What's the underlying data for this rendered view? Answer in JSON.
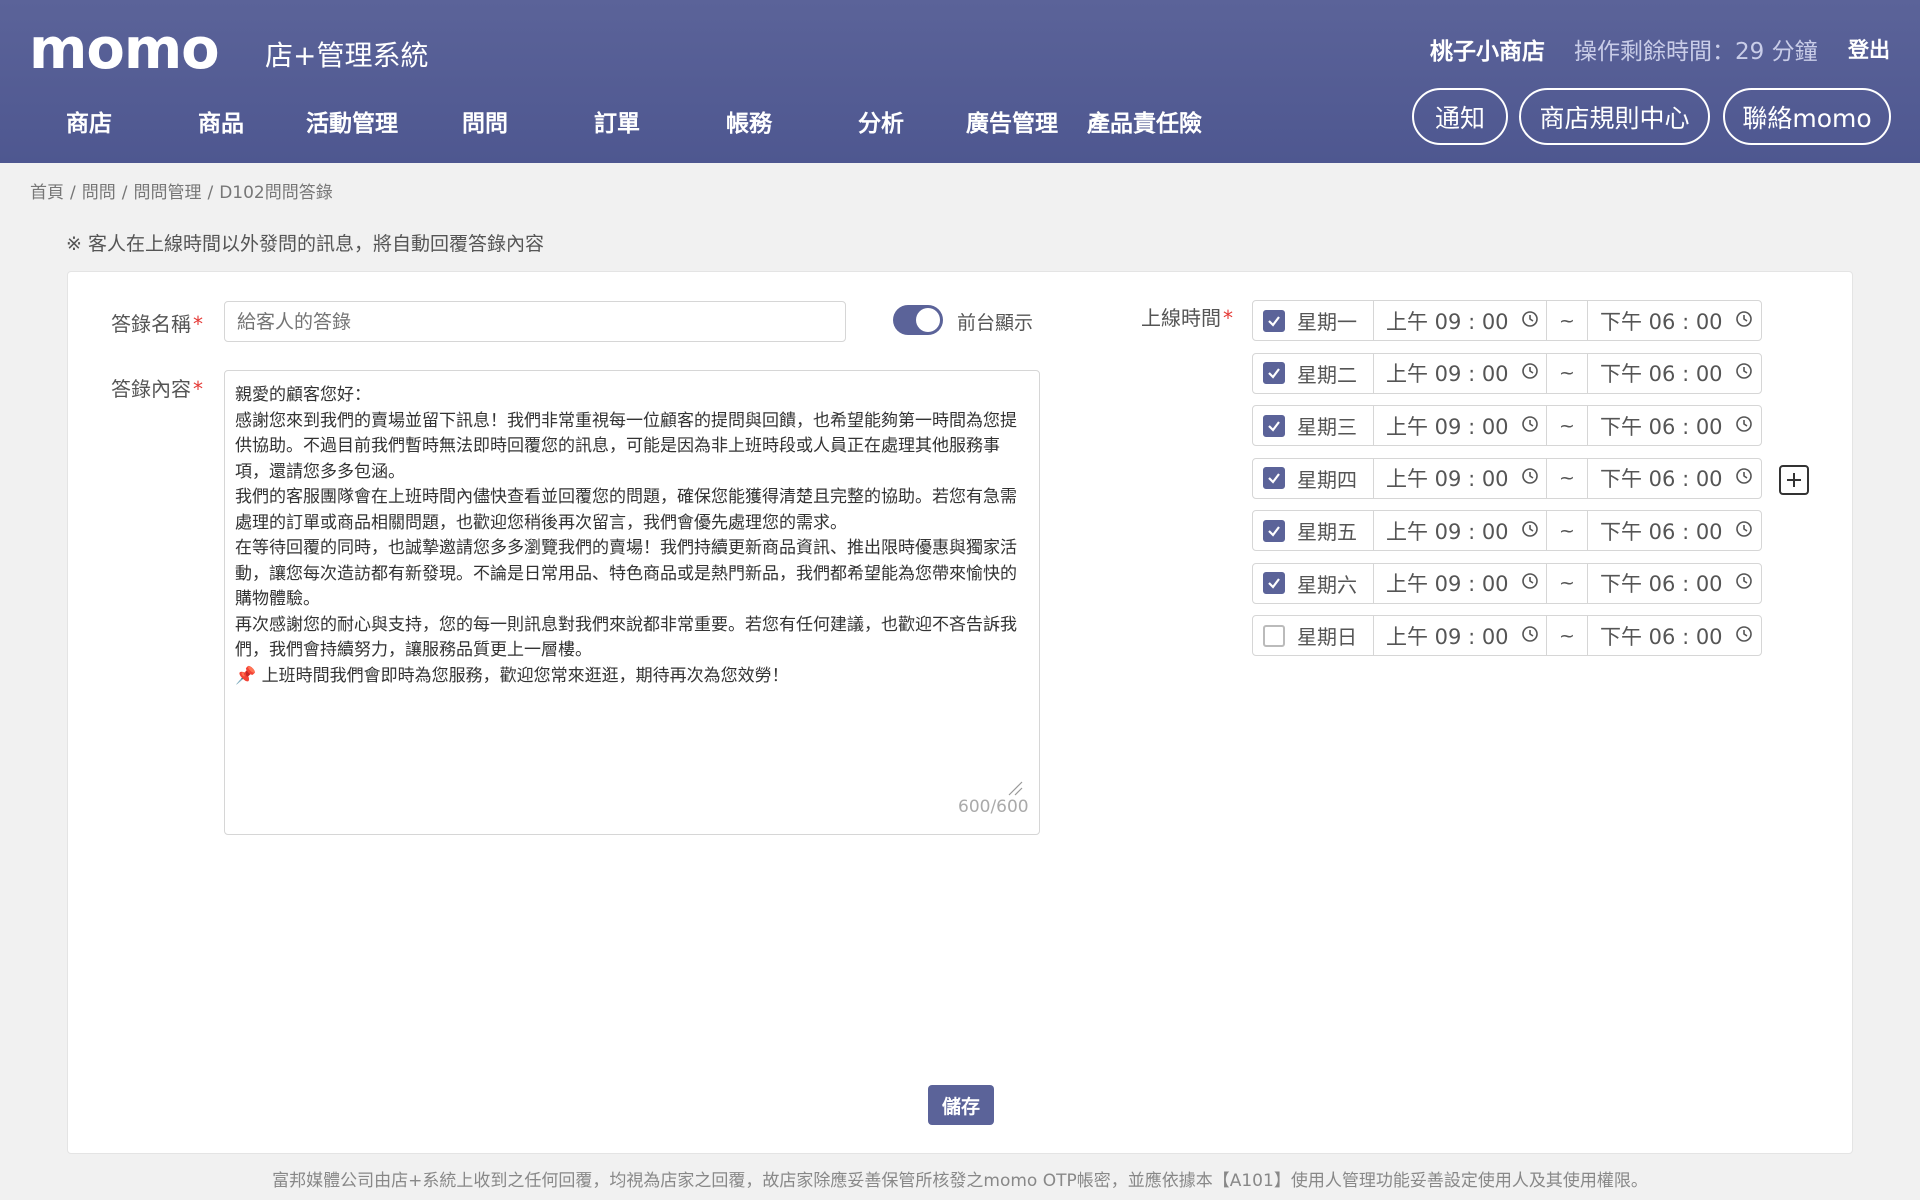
{
  "header": {
    "logo": "momo",
    "system_title": "店+管理系統",
    "shop_name": "桃子小商店",
    "remaining_time": "操作剩餘時間：29 分鐘",
    "logout": "登出",
    "nav": [
      "商店",
      "商品",
      "活動管理",
      "問問",
      "訂單",
      "帳務",
      "分析",
      "廣告管理",
      "產品責任險"
    ],
    "buttons": [
      "通知",
      "商店規則中心",
      "聯絡momo"
    ]
  },
  "breadcrumb": [
    "首頁",
    "問問",
    "問問管理",
    "D102問問答錄"
  ],
  "notice": "※ 客人在上線時間以外發問的訊息，將自動回覆答錄內容",
  "form": {
    "name_label": "答錄名稱",
    "name_placeholder": "給客人的答錄",
    "toggle_label": "前台顯示",
    "toggle_on": true,
    "content_label": "答錄內容",
    "content": "親愛的顧客您好：\n感謝您來到我們的賣場並留下訊息！我們非常重視每一位顧客的提問與回饋，也希望能夠第一時間為您提供協助。不過目前我們暫時無法即時回覆您的訊息，可能是因為非上班時段或人員正在處理其他服務事項，還請您多多包涵。\n我們的客服團隊會在上班時間內儘快查看並回覆您的問題，確保您能獲得清楚且完整的協助。若您有急需處理的訂單或商品相關問題，也歡迎您稍後再次留言，我們會優先處理您的需求。\n在等待回覆的同時，也誠摯邀請您多多瀏覽我們的賣場！我們持續更新商品資訊、推出限時優惠與獨家活動，讓您每次造訪都有新發現。不論是日常用品、特色商品或是熱門新品，我們都希望能為您帶來愉快的購物體驗。\n再次感謝您的耐心與支持，您的每一則訊息對我們來說都非常重要。若您有任何建議，也歡迎不吝告訴我們，我們會持續努力，讓服務品質更上一層樓。\n📌 上班時間我們會即時為您服務，歡迎您常來逛逛，期待再次為您效勞！",
    "counter": "600/600",
    "schedule_label": "上線時間",
    "schedule": [
      {
        "day": "星期一",
        "checked": true,
        "start": "上午 09 : 00",
        "end": "下午 06 : 00"
      },
      {
        "day": "星期二",
        "checked": true,
        "start": "上午 09 : 00",
        "end": "下午 06 : 00"
      },
      {
        "day": "星期三",
        "checked": true,
        "start": "上午 09 : 00",
        "end": "下午 06 : 00"
      },
      {
        "day": "星期四",
        "checked": true,
        "start": "上午 09 : 00",
        "end": "下午 06 : 00"
      },
      {
        "day": "星期五",
        "checked": true,
        "start": "上午 09 : 00",
        "end": "下午 06 : 00"
      },
      {
        "day": "星期六",
        "checked": true,
        "start": "上午 09 : 00",
        "end": "下午 06 : 00"
      },
      {
        "day": "星期日",
        "checked": false,
        "start": "上午 09 : 00",
        "end": "下午 06 : 00"
      }
    ],
    "tilde": "~",
    "save": "儲存"
  },
  "footer": "富邦媒體公司由店+系統上收到之任何回覆，均視為店家之回覆，故店家除應妥善保管所核發之momo OTP帳密，並應依據本【A101】使用人管理功能妥善設定使用人及其使用權限。",
  "colors": {
    "header": "#5b6399",
    "accent": "#5b6399",
    "required": "#e53935"
  }
}
